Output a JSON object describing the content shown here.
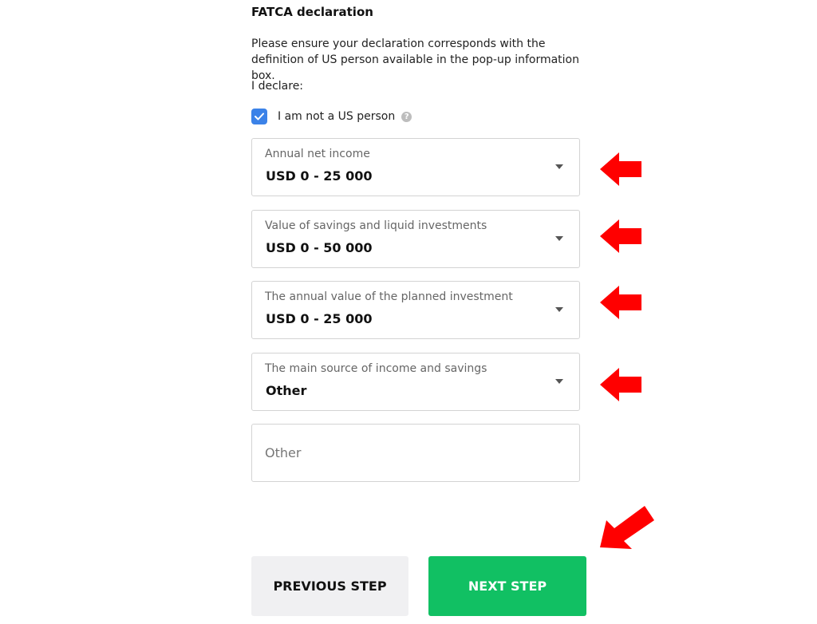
{
  "section": {
    "title": "FATCA declaration",
    "description": "Please ensure your declaration corresponds with the definition of US person available in the pop-up information box.",
    "declare_label": "I declare:"
  },
  "checkbox": {
    "label": "I am not a US person",
    "checked": true,
    "icon": "check-icon",
    "help_icon": "question-icon"
  },
  "fields": {
    "annual_income": {
      "label": "Annual net income",
      "value": "USD 0 - 25 000"
    },
    "savings": {
      "label": "Value of savings and liquid investments",
      "value": "USD 0 - 50 000"
    },
    "planned_investment": {
      "label": "The annual value of the planned investment",
      "value": "USD 0 - 25 000"
    },
    "income_source": {
      "label": "The main source of income and savings",
      "value": "Other"
    },
    "other_input": {
      "placeholder": "Other",
      "value": ""
    }
  },
  "buttons": {
    "previous": "PREVIOUS STEP",
    "next": "NEXT STEP"
  },
  "colors": {
    "accent_blue": "#3b82e8",
    "next_button_green": "#11c063",
    "annotation_red": "#ff0000"
  }
}
